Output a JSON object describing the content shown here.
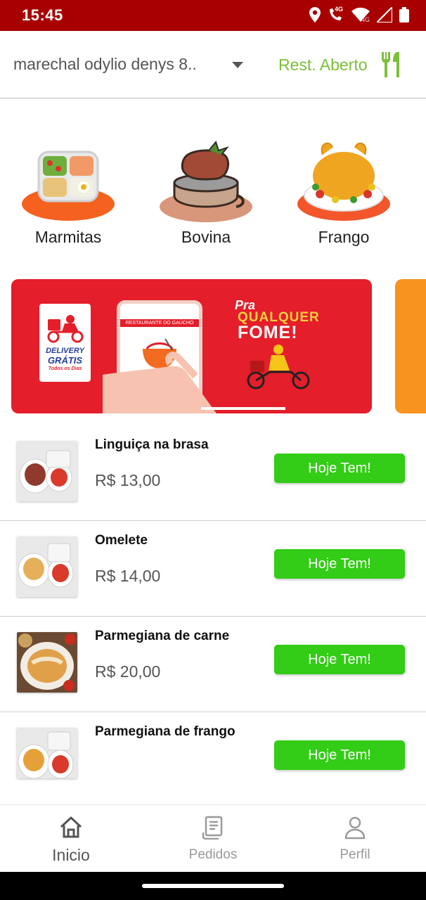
{
  "status_bar": {
    "time": "15:45",
    "icons": [
      "location-icon",
      "wifi-call-icon",
      "wifi-icon",
      "signal-icon",
      "battery-icon"
    ],
    "network_labels": [
      "4G",
      "4G"
    ]
  },
  "header": {
    "address": "marechal odylio denys 8..",
    "restaurant_status": "Rest. Aberto",
    "status_color": "#7cbf3a"
  },
  "categories": [
    {
      "label": "Marmitas",
      "icon": "marmita-icon"
    },
    {
      "label": "Bovina",
      "icon": "beef-icon"
    },
    {
      "label": "Frango",
      "icon": "chicken-icon"
    }
  ],
  "banner": {
    "badge_line1": "DELIVERY",
    "badge_line2": "GRÁTIS",
    "badge_line3": "Todos os Dias",
    "phone_brand": "RESTAURANTE DO GAÚCHO",
    "slogan_line1": "Pra",
    "slogan_line2": "QUALQUER",
    "slogan_line3": "FOME!",
    "primary_color": "#e41e2a",
    "next_color": "#f7931e"
  },
  "items": [
    {
      "name": "Linguiça na brasa",
      "price": "R$ 13,00",
      "button": "Hoje Tem!"
    },
    {
      "name": "Omelete",
      "price": "R$ 14,00",
      "button": "Hoje Tem!"
    },
    {
      "name": "Parmegiana de carne",
      "price": "R$ 20,00",
      "button": "Hoje Tem!"
    },
    {
      "name": "Parmegiana de frango",
      "price": "",
      "button": "Hoje Tem!"
    }
  ],
  "button_color": "#33cc16",
  "bottom_nav": [
    {
      "label": "Inicio",
      "icon": "home-icon",
      "active": true
    },
    {
      "label": "Pedidos",
      "icon": "receipt-icon",
      "active": false
    },
    {
      "label": "Perfil",
      "icon": "person-icon",
      "active": false
    }
  ]
}
